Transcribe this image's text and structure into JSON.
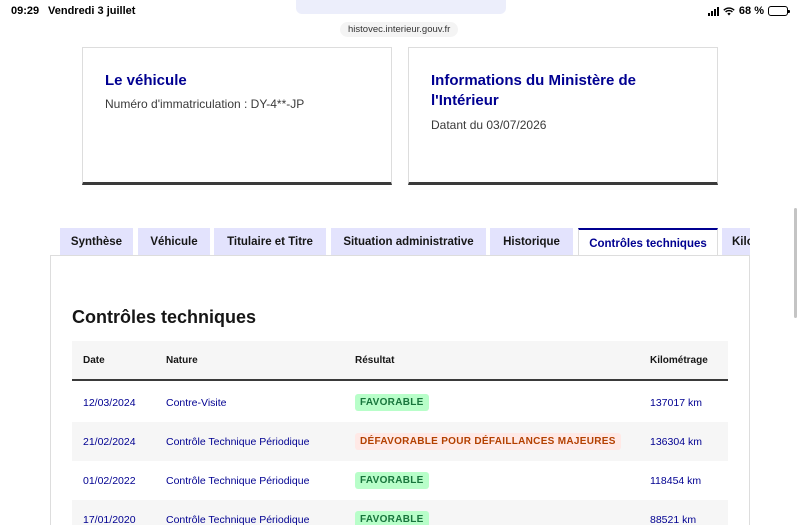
{
  "statusbar": {
    "time": "09:29",
    "date": "Vendredi 3 juillet",
    "battery": "68 %",
    "battery_level": 0.68
  },
  "browser": {
    "url": "histovec.interieur.gouv.fr"
  },
  "cards": {
    "vehicle": {
      "title": "Le véhicule",
      "plate": "Numéro d'immatriculation : DY-4**-JP"
    },
    "ministry": {
      "title": "Informations du Ministère de l'Intérieur",
      "date": "Datant du 03/07/2026"
    }
  },
  "tabs": [
    {
      "label": "Synthèse"
    },
    {
      "label": "Véhicule"
    },
    {
      "label": "Titulaire et Titre"
    },
    {
      "label": "Situation administrative"
    },
    {
      "label": "Historique"
    },
    {
      "label": "Contrôles techniques"
    },
    {
      "label": "Kilométrage"
    }
  ],
  "active_tab": "Contrôles techniques",
  "section": {
    "title": "Contrôles techniques",
    "columns": {
      "date": "Date",
      "nature": "Nature",
      "result": "Résultat",
      "km": "Kilométrage"
    },
    "rows": [
      {
        "date": "12/03/2024",
        "nature": "Contre-Visite",
        "result": "FAVORABLE",
        "status": "ok",
        "km": "137017 km"
      },
      {
        "date": "21/02/2024",
        "nature": "Contrôle Technique Périodique",
        "result": "DÉFAVORABLE POUR DÉFAILLANCES MAJEURES",
        "status": "bad",
        "km": "136304 km"
      },
      {
        "date": "01/02/2022",
        "nature": "Contrôle Technique Périodique",
        "result": "FAVORABLE",
        "status": "ok",
        "km": "118454 km"
      },
      {
        "date": "17/01/2020",
        "nature": "Contrôle Technique Périodique",
        "result": "FAVORABLE",
        "status": "ok",
        "km": "88521 km"
      }
    ]
  },
  "colors": {
    "accent": "#000091",
    "tab_bg": "#e3e3fd",
    "success_bg": "#b8fec9",
    "success_text": "#18753c",
    "error_bg": "#ffe9e6",
    "error_text": "#b34000"
  }
}
